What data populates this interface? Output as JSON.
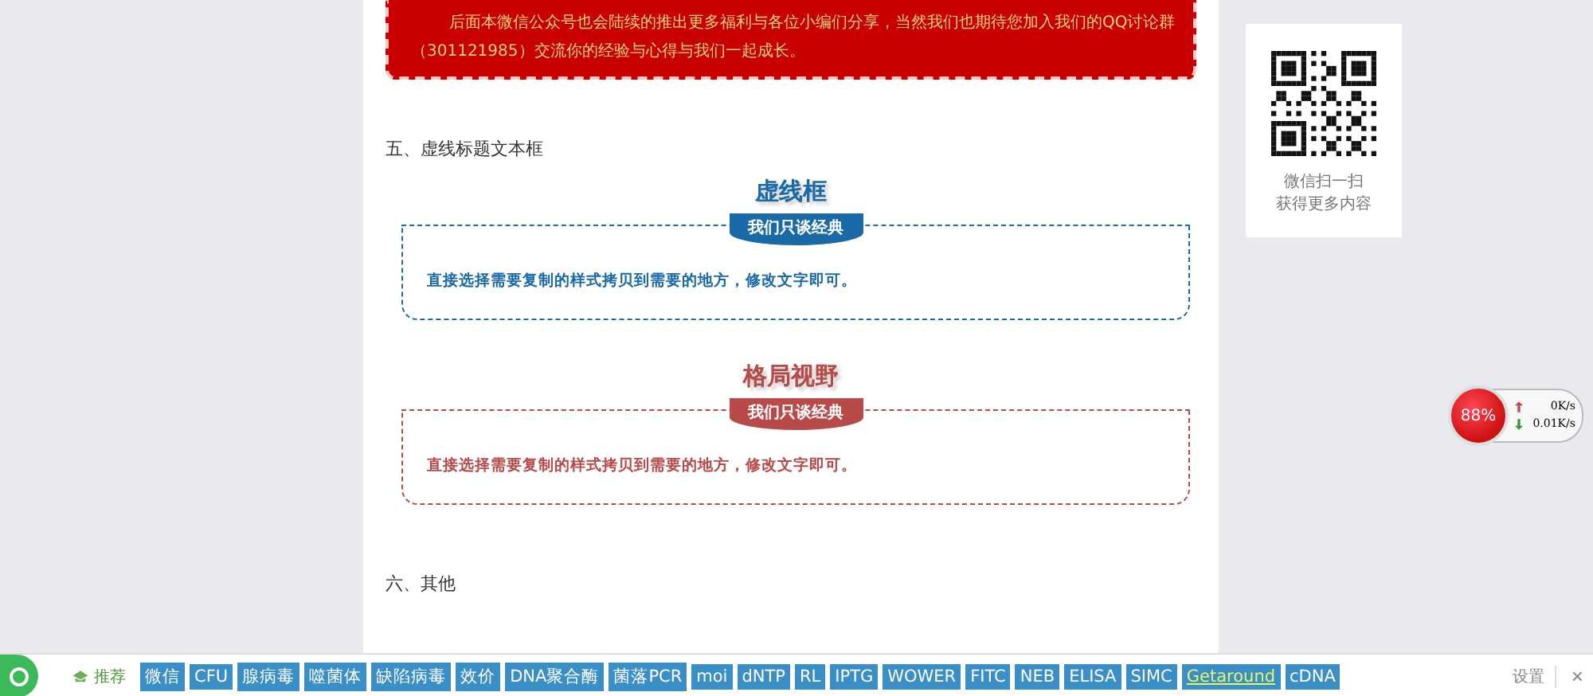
{
  "notice": {
    "text": "后面本微信公众号也会陆续的推出更多福利与各位小编们分享，当然我们也期待您加入我们的QQ讨论群（301121985）交流你的经验与心得与我们一起成长。"
  },
  "section_five": {
    "heading": "五、虚线标题文本框"
  },
  "style_boxes": [
    {
      "title": "虚线框",
      "badge": "我们只谈经典",
      "body": "直接选择需要复制的样式拷贝到需要的地方，修改文字即可。",
      "color": "#1a6aa8"
    },
    {
      "title": "格局视野",
      "badge": "我们只谈经典",
      "body": "直接选择需要复制的样式拷贝到需要的地方，修改文字即可。",
      "color": "#b94a4a"
    }
  ],
  "section_six": {
    "heading": "六、其他"
  },
  "qr_card": {
    "lines": [
      "微信扫一扫",
      "获得更多内容"
    ]
  },
  "speed_widget": {
    "percent": "88%",
    "upload": "0K/s",
    "download": "0.01K/s"
  },
  "bottom_bar": {
    "recommend": "推荐",
    "tags": [
      {
        "label": "微信",
        "highlighted": false
      },
      {
        "label": "CFU",
        "highlighted": false
      },
      {
        "label": "腺病毒",
        "highlighted": false
      },
      {
        "label": "噬菌体",
        "highlighted": false
      },
      {
        "label": "缺陷病毒",
        "highlighted": false
      },
      {
        "label": "效价",
        "highlighted": false
      },
      {
        "label": "DNA聚合酶",
        "highlighted": false
      },
      {
        "label": "菌落PCR",
        "highlighted": false
      },
      {
        "label": "moi",
        "highlighted": false
      },
      {
        "label": "dNTP",
        "highlighted": false
      },
      {
        "label": "RL",
        "highlighted": false
      },
      {
        "label": "IPTG",
        "highlighted": false
      },
      {
        "label": "WOWER",
        "highlighted": false
      },
      {
        "label": "FITC",
        "highlighted": false
      },
      {
        "label": "NEB",
        "highlighted": false
      },
      {
        "label": "ELISA",
        "highlighted": false
      },
      {
        "label": "SIMC",
        "highlighted": false
      },
      {
        "label": "Getaround",
        "highlighted": true
      },
      {
        "label": "cDNA",
        "highlighted": false
      }
    ],
    "settings": "设置",
    "close": "×"
  }
}
